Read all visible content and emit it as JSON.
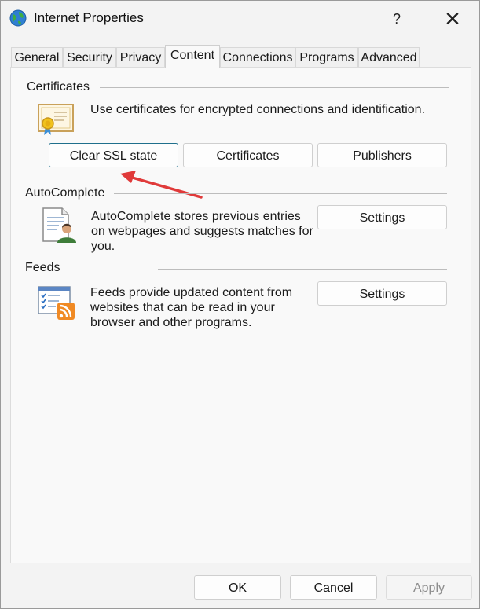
{
  "window": {
    "title": "Internet Properties",
    "help_glyph": "?",
    "close_glyph": "✕"
  },
  "tabs": [
    {
      "label": "General"
    },
    {
      "label": "Security"
    },
    {
      "label": "Privacy"
    },
    {
      "label": "Content",
      "active": true
    },
    {
      "label": "Connections"
    },
    {
      "label": "Programs"
    },
    {
      "label": "Advanced"
    }
  ],
  "certificates": {
    "heading": "Certificates",
    "description": "Use certificates for encrypted connections and identification.",
    "clear_ssl_label": "Clear SSL state",
    "certificates_label": "Certificates",
    "publishers_label": "Publishers",
    "icon": "certificate-icon"
  },
  "autocomplete": {
    "heading": "AutoComplete",
    "description_lines": [
      "AutoComplete stores previous entries",
      "on webpages and suggests matches for",
      "you."
    ],
    "settings_label": "Settings",
    "icon": "autocomplete-icon"
  },
  "feeds": {
    "heading": "Feeds",
    "description_lines": [
      "Feeds provide updated content from",
      "websites that can be read in your",
      "browser and other programs."
    ],
    "settings_label": "Settings",
    "icon": "feeds-icon"
  },
  "footer": {
    "ok_label": "OK",
    "cancel_label": "Cancel",
    "apply_label": "Apply"
  },
  "colors": {
    "annotation_arrow": "#e03a3a",
    "focus_border": "#1f6f8c"
  }
}
